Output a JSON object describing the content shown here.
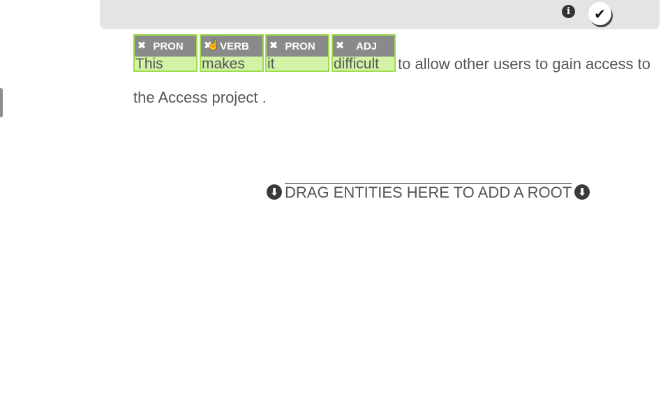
{
  "toolbar": {
    "info_icon": "i",
    "confirm_icon": "✔"
  },
  "sentence": {
    "tokens": [
      {
        "tag": "PRON",
        "word": "This"
      },
      {
        "tag": "VERB",
        "word": "makes"
      },
      {
        "tag": "PRON",
        "word": "it"
      },
      {
        "tag": "ADJ",
        "word": "difficult"
      }
    ],
    "remove_icon": "✖",
    "rest_line1": "to allow other users to gain access to",
    "rest_line2": "the Access project ."
  },
  "drop_zone": {
    "label": "DRAG ENTITIES HERE TO ADD A ROOT",
    "arrow_icon": "⬇"
  },
  "colors": {
    "token_border": "#9edc4c",
    "token_fill": "#d2f2a6",
    "tag_fill": "#8a8a8a"
  }
}
